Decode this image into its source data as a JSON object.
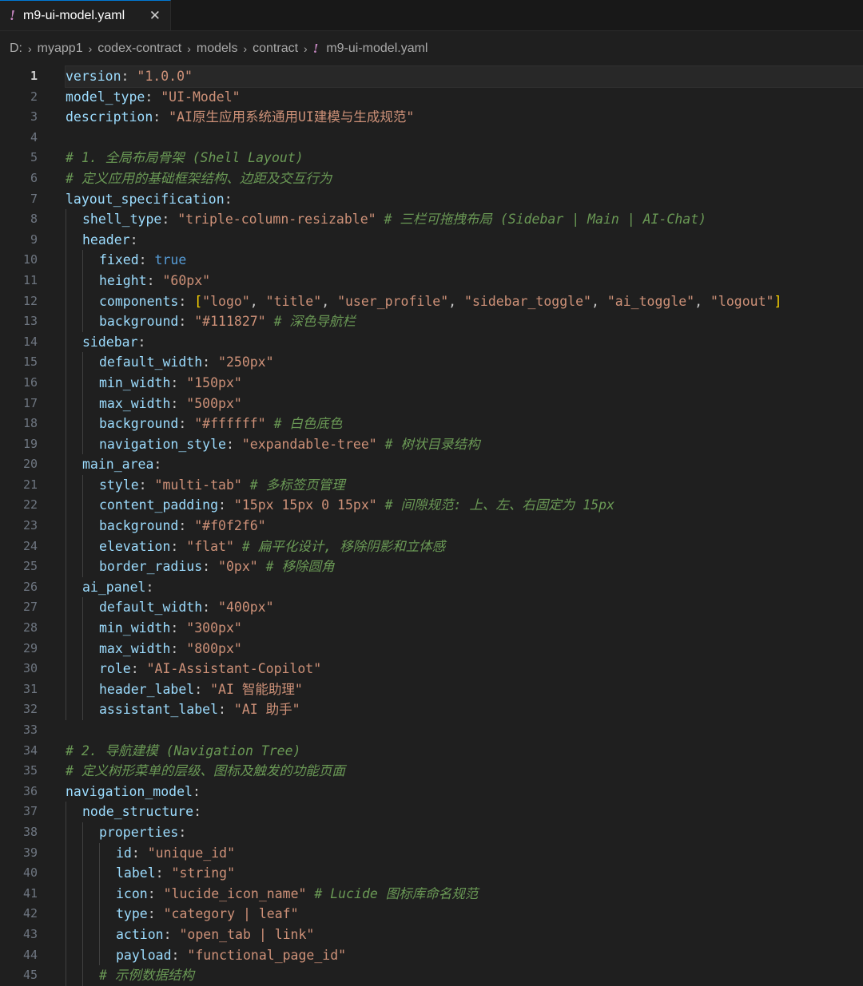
{
  "tab": {
    "title": "m9-ui-model.yaml",
    "close": "✕"
  },
  "breadcrumb": [
    "D:",
    "myapp1",
    "codex-contract",
    "models",
    "contract",
    "m9-ui-model.yaml"
  ],
  "icons": {
    "yaml": "!",
    "chevron": "›"
  },
  "colors": {
    "key": "#9cdcfe",
    "string": "#ce9178",
    "comment": "#6a9955",
    "boolean": "#569cd6",
    "bracket": "#ffd700",
    "yaml_icon": "#c586c0"
  },
  "lines": [
    {
      "indent": 0,
      "tokens": [
        [
          "k",
          "version"
        ],
        [
          "p",
          ": "
        ],
        [
          "s",
          "\"1.0.0\""
        ]
      ]
    },
    {
      "indent": 0,
      "tokens": [
        [
          "k",
          "model_type"
        ],
        [
          "p",
          ": "
        ],
        [
          "s",
          "\"UI-Model\""
        ]
      ]
    },
    {
      "indent": 0,
      "tokens": [
        [
          "k",
          "description"
        ],
        [
          "p",
          ": "
        ],
        [
          "s",
          "\"AI原生应用系统通用UI建模与生成规范\""
        ]
      ]
    },
    {
      "indent": 0,
      "tokens": []
    },
    {
      "indent": 0,
      "tokens": [
        [
          "c",
          "# 1. 全局布局骨架 (Shell Layout)"
        ]
      ]
    },
    {
      "indent": 0,
      "tokens": [
        [
          "c",
          "# 定义应用的基础框架结构、边距及交互行为"
        ]
      ]
    },
    {
      "indent": 0,
      "tokens": [
        [
          "k",
          "layout_specification"
        ],
        [
          "p",
          ":"
        ]
      ]
    },
    {
      "indent": 1,
      "tokens": [
        [
          "k",
          "shell_type"
        ],
        [
          "p",
          ": "
        ],
        [
          "s",
          "\"triple-column-resizable\""
        ],
        [
          "p",
          " "
        ],
        [
          "c",
          "# 三栏可拖拽布局 (Sidebar | Main | AI-Chat)"
        ]
      ]
    },
    {
      "indent": 1,
      "tokens": [
        [
          "k",
          "header"
        ],
        [
          "p",
          ":"
        ]
      ]
    },
    {
      "indent": 2,
      "tokens": [
        [
          "k",
          "fixed"
        ],
        [
          "p",
          ": "
        ],
        [
          "b",
          "true"
        ]
      ]
    },
    {
      "indent": 2,
      "tokens": [
        [
          "k",
          "height"
        ],
        [
          "p",
          ": "
        ],
        [
          "s",
          "\"60px\""
        ]
      ]
    },
    {
      "indent": 2,
      "tokens": [
        [
          "k",
          "components"
        ],
        [
          "p",
          ": "
        ],
        [
          "y",
          "["
        ],
        [
          "s",
          "\"logo\""
        ],
        [
          "p",
          ", "
        ],
        [
          "s",
          "\"title\""
        ],
        [
          "p",
          ", "
        ],
        [
          "s",
          "\"user_profile\""
        ],
        [
          "p",
          ", "
        ],
        [
          "s",
          "\"sidebar_toggle\""
        ],
        [
          "p",
          ", "
        ],
        [
          "s",
          "\"ai_toggle\""
        ],
        [
          "p",
          ", "
        ],
        [
          "s",
          "\"logout\""
        ],
        [
          "y",
          "]"
        ]
      ]
    },
    {
      "indent": 2,
      "tokens": [
        [
          "k",
          "background"
        ],
        [
          "p",
          ": "
        ],
        [
          "s",
          "\"#111827\""
        ],
        [
          "p",
          " "
        ],
        [
          "c",
          "# 深色导航栏"
        ]
      ]
    },
    {
      "indent": 1,
      "tokens": [
        [
          "k",
          "sidebar"
        ],
        [
          "p",
          ":"
        ]
      ]
    },
    {
      "indent": 2,
      "tokens": [
        [
          "k",
          "default_width"
        ],
        [
          "p",
          ": "
        ],
        [
          "s",
          "\"250px\""
        ]
      ]
    },
    {
      "indent": 2,
      "tokens": [
        [
          "k",
          "min_width"
        ],
        [
          "p",
          ": "
        ],
        [
          "s",
          "\"150px\""
        ]
      ]
    },
    {
      "indent": 2,
      "tokens": [
        [
          "k",
          "max_width"
        ],
        [
          "p",
          ": "
        ],
        [
          "s",
          "\"500px\""
        ]
      ]
    },
    {
      "indent": 2,
      "tokens": [
        [
          "k",
          "background"
        ],
        [
          "p",
          ": "
        ],
        [
          "s",
          "\"#ffffff\""
        ],
        [
          "p",
          " "
        ],
        [
          "c",
          "# 白色底色"
        ]
      ]
    },
    {
      "indent": 2,
      "tokens": [
        [
          "k",
          "navigation_style"
        ],
        [
          "p",
          ": "
        ],
        [
          "s",
          "\"expandable-tree\""
        ],
        [
          "p",
          " "
        ],
        [
          "c",
          "# 树状目录结构"
        ]
      ]
    },
    {
      "indent": 1,
      "tokens": [
        [
          "k",
          "main_area"
        ],
        [
          "p",
          ":"
        ]
      ]
    },
    {
      "indent": 2,
      "tokens": [
        [
          "k",
          "style"
        ],
        [
          "p",
          ": "
        ],
        [
          "s",
          "\"multi-tab\""
        ],
        [
          "p",
          " "
        ],
        [
          "c",
          "# 多标签页管理"
        ]
      ]
    },
    {
      "indent": 2,
      "tokens": [
        [
          "k",
          "content_padding"
        ],
        [
          "p",
          ": "
        ],
        [
          "s",
          "\"15px 15px 0 15px\""
        ],
        [
          "p",
          " "
        ],
        [
          "c",
          "# 间隙规范: 上、左、右固定为 15px"
        ]
      ]
    },
    {
      "indent": 2,
      "tokens": [
        [
          "k",
          "background"
        ],
        [
          "p",
          ": "
        ],
        [
          "s",
          "\"#f0f2f6\""
        ]
      ]
    },
    {
      "indent": 2,
      "tokens": [
        [
          "k",
          "elevation"
        ],
        [
          "p",
          ": "
        ],
        [
          "s",
          "\"flat\""
        ],
        [
          "p",
          " "
        ],
        [
          "c",
          "# 扁平化设计, 移除阴影和立体感"
        ]
      ]
    },
    {
      "indent": 2,
      "tokens": [
        [
          "k",
          "border_radius"
        ],
        [
          "p",
          ": "
        ],
        [
          "s",
          "\"0px\""
        ],
        [
          "p",
          " "
        ],
        [
          "c",
          "# 移除圆角"
        ]
      ]
    },
    {
      "indent": 1,
      "tokens": [
        [
          "k",
          "ai_panel"
        ],
        [
          "p",
          ":"
        ]
      ]
    },
    {
      "indent": 2,
      "tokens": [
        [
          "k",
          "default_width"
        ],
        [
          "p",
          ": "
        ],
        [
          "s",
          "\"400px\""
        ]
      ]
    },
    {
      "indent": 2,
      "tokens": [
        [
          "k",
          "min_width"
        ],
        [
          "p",
          ": "
        ],
        [
          "s",
          "\"300px\""
        ]
      ]
    },
    {
      "indent": 2,
      "tokens": [
        [
          "k",
          "max_width"
        ],
        [
          "p",
          ": "
        ],
        [
          "s",
          "\"800px\""
        ]
      ]
    },
    {
      "indent": 2,
      "tokens": [
        [
          "k",
          "role"
        ],
        [
          "p",
          ": "
        ],
        [
          "s",
          "\"AI-Assistant-Copilot\""
        ]
      ]
    },
    {
      "indent": 2,
      "tokens": [
        [
          "k",
          "header_label"
        ],
        [
          "p",
          ": "
        ],
        [
          "s",
          "\"AI 智能助理\""
        ]
      ]
    },
    {
      "indent": 2,
      "tokens": [
        [
          "k",
          "assistant_label"
        ],
        [
          "p",
          ": "
        ],
        [
          "s",
          "\"AI 助手\""
        ]
      ]
    },
    {
      "indent": 0,
      "tokens": []
    },
    {
      "indent": 0,
      "tokens": [
        [
          "c",
          "# 2. 导航建模 (Navigation Tree)"
        ]
      ]
    },
    {
      "indent": 0,
      "tokens": [
        [
          "c",
          "# 定义树形菜单的层级、图标及触发的功能页面"
        ]
      ]
    },
    {
      "indent": 0,
      "tokens": [
        [
          "k",
          "navigation_model"
        ],
        [
          "p",
          ":"
        ]
      ]
    },
    {
      "indent": 1,
      "tokens": [
        [
          "k",
          "node_structure"
        ],
        [
          "p",
          ":"
        ]
      ]
    },
    {
      "indent": 2,
      "tokens": [
        [
          "k",
          "properties"
        ],
        [
          "p",
          ":"
        ]
      ]
    },
    {
      "indent": 3,
      "tokens": [
        [
          "k",
          "id"
        ],
        [
          "p",
          ": "
        ],
        [
          "s",
          "\"unique_id\""
        ]
      ]
    },
    {
      "indent": 3,
      "tokens": [
        [
          "k",
          "label"
        ],
        [
          "p",
          ": "
        ],
        [
          "s",
          "\"string\""
        ]
      ]
    },
    {
      "indent": 3,
      "tokens": [
        [
          "k",
          "icon"
        ],
        [
          "p",
          ": "
        ],
        [
          "s",
          "\"lucide_icon_name\""
        ],
        [
          "p",
          " "
        ],
        [
          "c",
          "# Lucide 图标库命名规范"
        ]
      ]
    },
    {
      "indent": 3,
      "tokens": [
        [
          "k",
          "type"
        ],
        [
          "p",
          ": "
        ],
        [
          "s",
          "\"category | leaf\""
        ]
      ]
    },
    {
      "indent": 3,
      "tokens": [
        [
          "k",
          "action"
        ],
        [
          "p",
          ": "
        ],
        [
          "s",
          "\"open_tab | link\""
        ]
      ]
    },
    {
      "indent": 3,
      "tokens": [
        [
          "k",
          "payload"
        ],
        [
          "p",
          ": "
        ],
        [
          "s",
          "\"functional_page_id\""
        ]
      ]
    },
    {
      "indent": 2,
      "tokens": [
        [
          "c",
          "# 示例数据结构"
        ]
      ]
    }
  ]
}
